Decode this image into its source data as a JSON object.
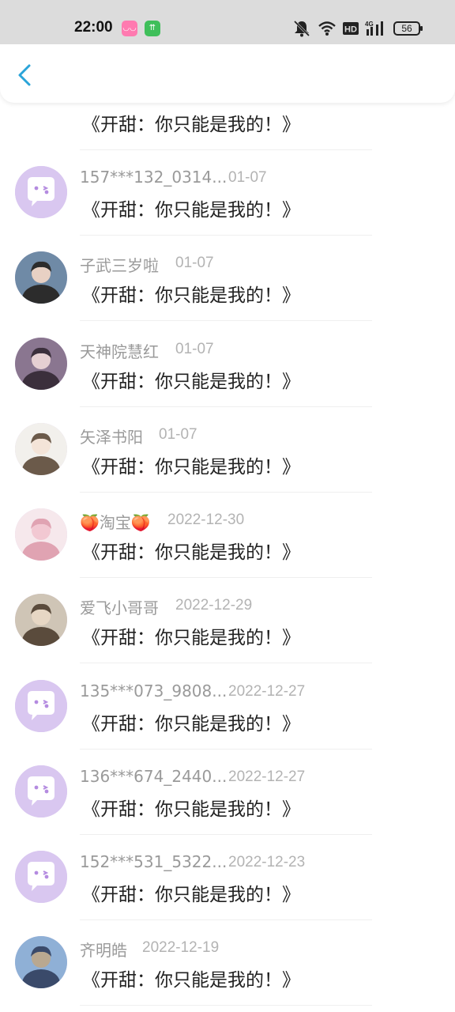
{
  "status_bar": {
    "time": "22:00",
    "battery": "56",
    "icons": [
      "bilibili-app-icon",
      "green-app-icon",
      "mute-bell-icon",
      "wifi-icon",
      "hd-icon",
      "signal-4g-icon",
      "battery-icon"
    ]
  },
  "nav": {
    "back_icon": "chevron-left-icon"
  },
  "colors": {
    "accent": "#2aa4d9",
    "avatar_default": "#d9c7f0",
    "username": "#9a9a9a",
    "date": "#b3b3b3"
  },
  "comments": [
    {
      "username": "",
      "date": "",
      "message": "《开甜：你只能是我的！》",
      "avatar": "default-chat-bubble"
    },
    {
      "username": "157***132_0314...",
      "date": "01-07",
      "message": "《开甜：你只能是我的！》",
      "avatar": "default-chat-bubble"
    },
    {
      "username": "子武三岁啦",
      "date": "01-07",
      "message": "《开甜：你只能是我的！》",
      "avatar": "photo-girl-black-dress"
    },
    {
      "username": "天神院慧红",
      "date": "01-07",
      "message": "《开甜：你只能是我的！》",
      "avatar": "photo-couple"
    },
    {
      "username": "矢泽书阳",
      "date": "01-07",
      "message": "《开甜：你只能是我的！》",
      "avatar": "illustration-girl"
    },
    {
      "username": "🍑淘宝🍑",
      "date": "2022-12-30",
      "message": "《开甜：你只能是我的！》",
      "avatar": "photo-pink-flowers"
    },
    {
      "username": "爱飞小哥哥",
      "date": "2022-12-29",
      "message": "《开甜：你只能是我的！》",
      "avatar": "illustration-boy"
    },
    {
      "username": "135***073_9808...",
      "date": "2022-12-27",
      "message": "《开甜：你只能是我的！》",
      "avatar": "default-chat-bubble"
    },
    {
      "username": "136***674_2440...",
      "date": "2022-12-27",
      "message": "《开甜：你只能是我的！》",
      "avatar": "default-chat-bubble"
    },
    {
      "username": "152***531_5322...",
      "date": "2022-12-23",
      "message": "《开甜：你只能是我的！》",
      "avatar": "default-chat-bubble"
    },
    {
      "username": "齐明皓",
      "date": "2022-12-19",
      "message": "《开甜：你只能是我的！》",
      "avatar": "photo-person-outdoors"
    }
  ]
}
